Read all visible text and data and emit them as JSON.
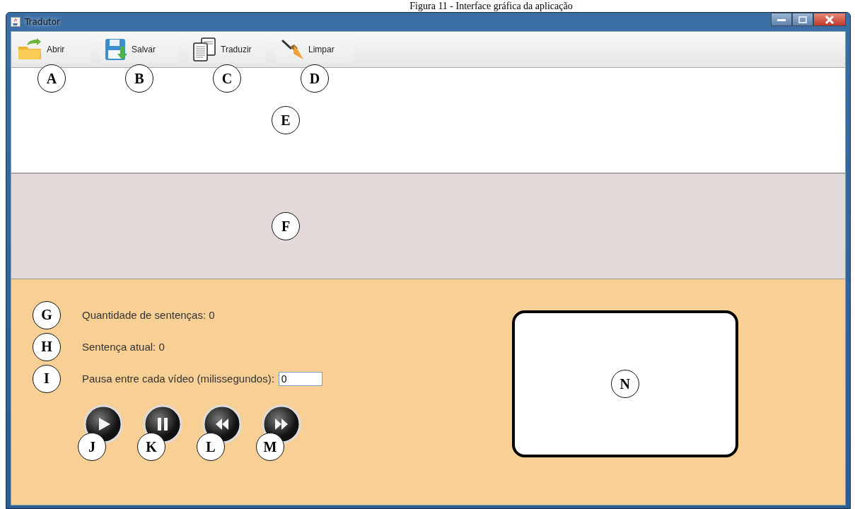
{
  "caption": "Figura 11 - Interface gráfica da aplicação",
  "window": {
    "title": "Tradutor"
  },
  "toolbar": [
    {
      "label": "Abrir",
      "kind": "folder",
      "callout": "A"
    },
    {
      "label": "Salvar",
      "kind": "floppy",
      "callout": "B"
    },
    {
      "label": "Traduzir",
      "kind": "documents",
      "callout": "C"
    },
    {
      "label": "Limpar",
      "kind": "brush",
      "callout": "D"
    }
  ],
  "input_area": {
    "callout": "E"
  },
  "output_area": {
    "callout": "F"
  },
  "stats": [
    {
      "text": "Quantidade de sentenças: 0",
      "callout": "G"
    },
    {
      "text": "Sentença atual: 0",
      "callout": "H"
    }
  ],
  "pause": {
    "label": "Pausa entre cada vídeo (milissegundos):",
    "value": "0",
    "callout": "I"
  },
  "media_buttons": [
    {
      "kind": "play",
      "callout": "J"
    },
    {
      "kind": "pause",
      "callout": "K"
    },
    {
      "kind": "rewind",
      "callout": "L"
    },
    {
      "kind": "forward",
      "callout": "M"
    }
  ],
  "video": {
    "callout": "N"
  }
}
